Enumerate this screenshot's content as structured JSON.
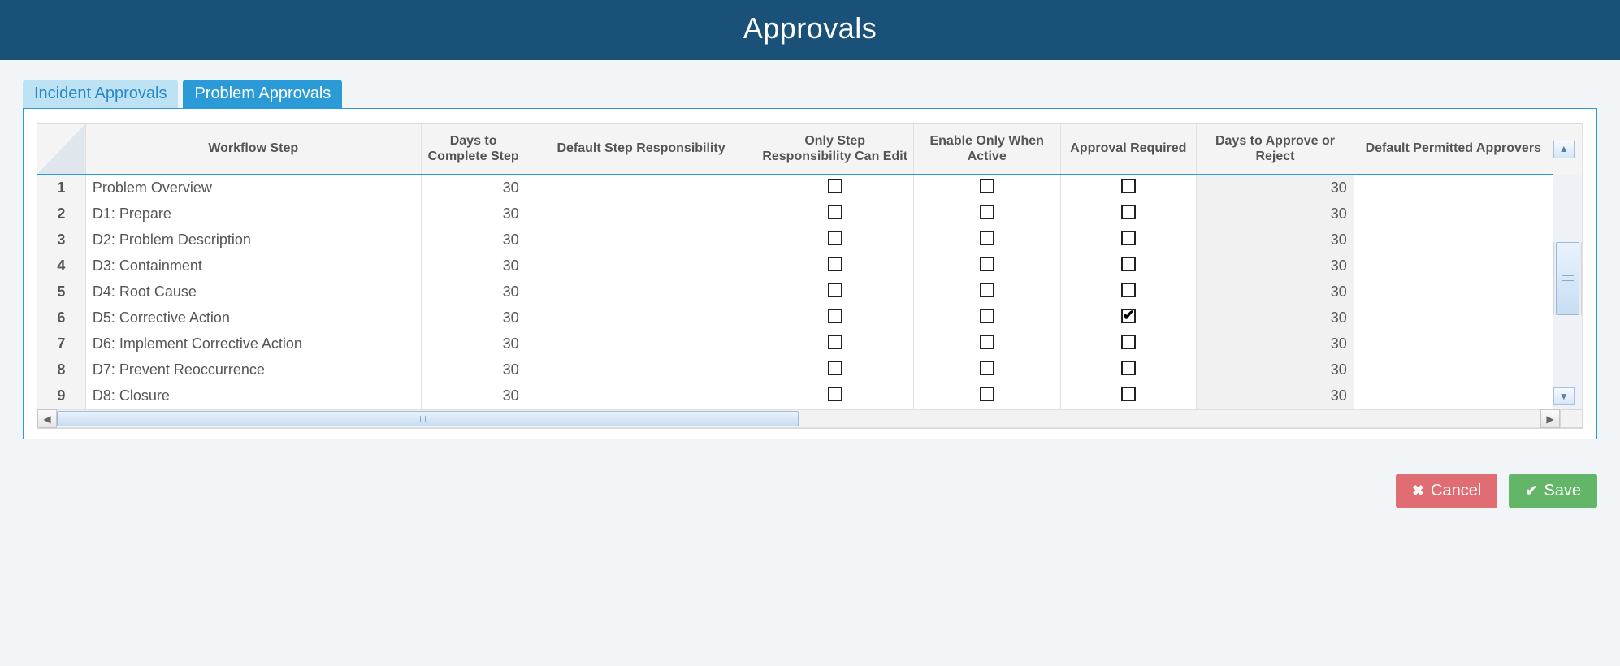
{
  "header": {
    "title": "Approvals"
  },
  "tabs": [
    {
      "label": "Incident Approvals",
      "active": false
    },
    {
      "label": "Problem Approvals",
      "active": true
    }
  ],
  "columns": {
    "workflow_step": "Workflow Step",
    "days_complete": "Days to Complete Step",
    "default_resp": "Default Step Responsibility",
    "only_resp_edit": "Only Step Responsibility Can Edit",
    "enable_active": "Enable Only When Active",
    "approval_required": "Approval Required",
    "days_approve": "Days to Approve or Reject",
    "permitted_approvers": "Default Permitted Approvers"
  },
  "rows": [
    {
      "n": "1",
      "step": "Problem Overview",
      "days_complete": "30",
      "default_resp": "",
      "only_resp_edit": false,
      "enable_active": false,
      "approval_required": false,
      "days_approve": "30",
      "approvers": ""
    },
    {
      "n": "2",
      "step": "D1: Prepare",
      "days_complete": "30",
      "default_resp": "",
      "only_resp_edit": false,
      "enable_active": false,
      "approval_required": false,
      "days_approve": "30",
      "approvers": ""
    },
    {
      "n": "3",
      "step": "D2: Problem Description",
      "days_complete": "30",
      "default_resp": "",
      "only_resp_edit": false,
      "enable_active": false,
      "approval_required": false,
      "days_approve": "30",
      "approvers": ""
    },
    {
      "n": "4",
      "step": "D3: Containment",
      "days_complete": "30",
      "default_resp": "",
      "only_resp_edit": false,
      "enable_active": false,
      "approval_required": false,
      "days_approve": "30",
      "approvers": ""
    },
    {
      "n": "5",
      "step": "D4: Root Cause",
      "days_complete": "30",
      "default_resp": "",
      "only_resp_edit": false,
      "enable_active": false,
      "approval_required": false,
      "days_approve": "30",
      "approvers": ""
    },
    {
      "n": "6",
      "step": "D5: Corrective Action",
      "days_complete": "30",
      "default_resp": "",
      "only_resp_edit": false,
      "enable_active": false,
      "approval_required": true,
      "days_approve": "30",
      "approvers": ""
    },
    {
      "n": "7",
      "step": "D6: Implement Corrective Action",
      "days_complete": "30",
      "default_resp": "",
      "only_resp_edit": false,
      "enable_active": false,
      "approval_required": false,
      "days_approve": "30",
      "approvers": ""
    },
    {
      "n": "8",
      "step": "D7: Prevent Reoccurrence",
      "days_complete": "30",
      "default_resp": "",
      "only_resp_edit": false,
      "enable_active": false,
      "approval_required": false,
      "days_approve": "30",
      "approvers": ""
    },
    {
      "n": "9",
      "step": "D8: Closure",
      "days_complete": "30",
      "default_resp": "",
      "only_resp_edit": false,
      "enable_active": false,
      "approval_required": false,
      "days_approve": "30",
      "approvers": ""
    }
  ],
  "buttons": {
    "cancel": "Cancel",
    "save": "Save"
  }
}
